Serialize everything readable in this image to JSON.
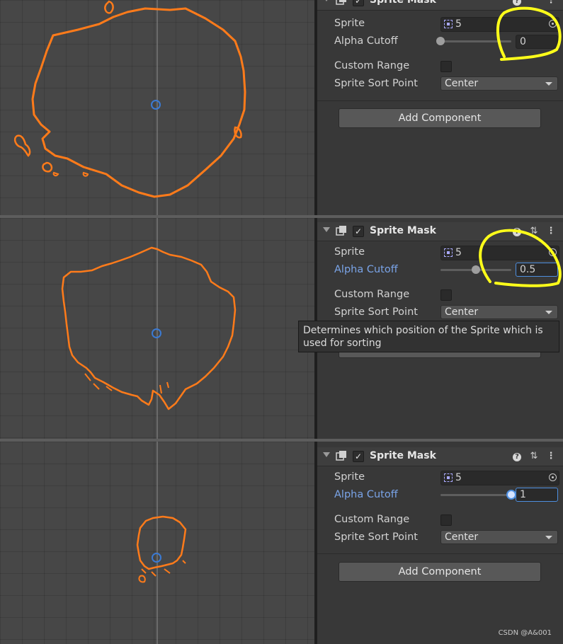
{
  "panels": [
    {
      "component": {
        "title": "Sprite Mask",
        "enabled_mark": "✓"
      },
      "sprite": {
        "label": "Sprite",
        "value": "5"
      },
      "alpha_cutoff": {
        "label": "Alpha Cutoff",
        "value": "0",
        "level": 0.0
      },
      "custom_range": {
        "label": "Custom Range"
      },
      "sort_point": {
        "label": "Sprite Sort Point",
        "value": "Center"
      },
      "add_component": "Add Component"
    },
    {
      "component": {
        "title": "Sprite Mask",
        "enabled_mark": "✓"
      },
      "sprite": {
        "label": "Sprite",
        "value": "5"
      },
      "alpha_cutoff": {
        "label": "Alpha Cutoff",
        "value": "0.5",
        "level": 0.5
      },
      "custom_range": {
        "label": "Custom Range"
      },
      "sort_point": {
        "label": "Sprite Sort Point",
        "value": "Center"
      }
    },
    {
      "component": {
        "title": "Sprite Mask",
        "enabled_mark": "✓"
      },
      "sprite": {
        "label": "Sprite",
        "value": "5"
      },
      "alpha_cutoff": {
        "label": "Alpha Cutoff",
        "value": "1",
        "level": 1.0
      },
      "custom_range": {
        "label": "Custom Range"
      },
      "sort_point": {
        "label": "Sprite Sort Point",
        "value": "Center"
      },
      "add_component": "Add Component"
    }
  ],
  "tooltip": "Determines which position of the Sprite which is used for sorting",
  "watermark": "CSDN @A&001",
  "colors": {
    "mask_outline": "#ff7b1a",
    "highlight": "#ffff1a",
    "active_label": "#7aa4e8",
    "focus_border": "#4d8fe0"
  },
  "icons": {
    "fold": "foldout-arrow-icon",
    "component": "sprite-mask-component-icon",
    "help": "help-icon",
    "preset": "preset-sliders-icon",
    "menu": "kebab-menu-icon",
    "picker": "object-picker-icon",
    "sprite": "sprite-asset-icon"
  }
}
